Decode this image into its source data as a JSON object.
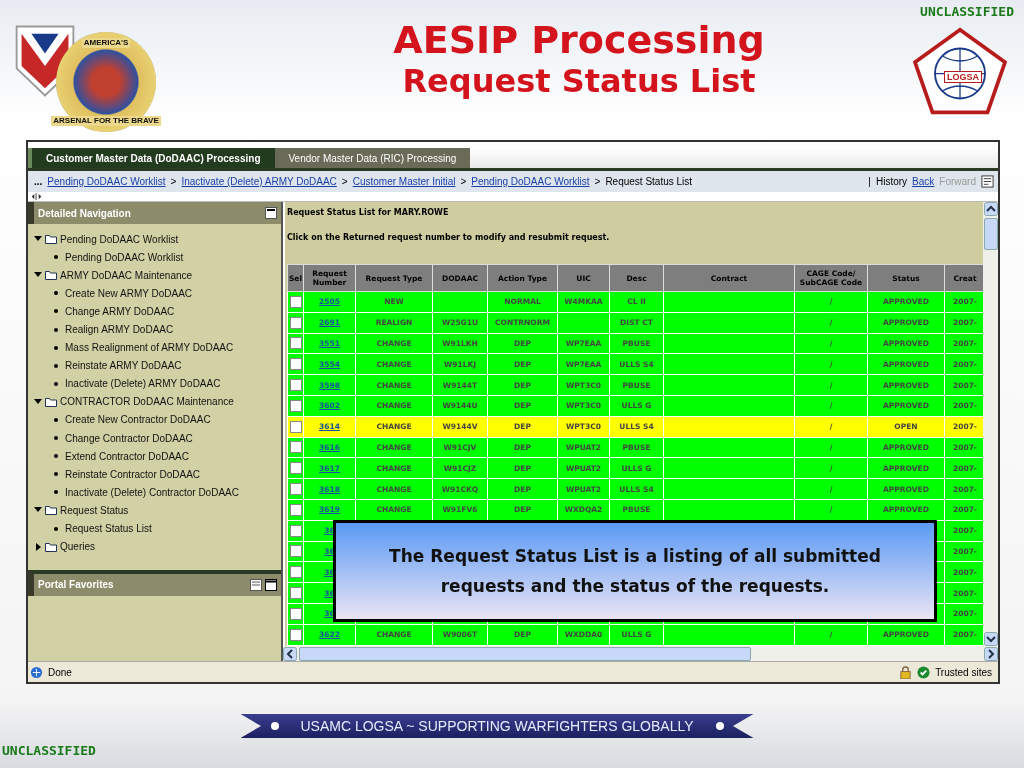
{
  "slide": {
    "title": "AESIP Processing",
    "subtitle": "Request Status List",
    "classification_top": "UNCLASSIFIED",
    "classification_bottom": "UNCLASSIFIED",
    "banner": "USAMC LOGSA ~ SUPPORTING WARFIGHTERS GLOBALLY",
    "left_logo": {
      "top_text": "AMERICA'S",
      "bottom_text": "ARSENAL FOR THE BRAVE"
    },
    "right_logo": {
      "text": "LOGSA"
    }
  },
  "browser": {
    "tabs": [
      {
        "label": "Customer Master Data (DoDAAC) Processing",
        "selected": true
      },
      {
        "label": "Vendor Master Data (RIC) Processing",
        "selected": false
      }
    ],
    "breadcrumb": {
      "lead": "...",
      "items": [
        {
          "label": "Pending DoDAAC Worklist",
          "link": true
        },
        {
          "label": "Inactivate (Delete) ARMY DoDAAC",
          "link": true
        },
        {
          "label": "Customer Master Initial",
          "link": true
        },
        {
          "label": "Pending DoDAAC Worklist",
          "link": true
        },
        {
          "label": "Request Status List",
          "link": false
        }
      ],
      "separator": ">"
    },
    "history": {
      "divider": "|",
      "history": "History",
      "back": "Back",
      "forward": "Forward"
    },
    "navigation": {
      "title": "Detailed Navigation",
      "tree": [
        {
          "label": "Pending DoDAAC Worklist",
          "expanded": true,
          "children": [
            {
              "label": "Pending DoDAAC Worklist"
            }
          ]
        },
        {
          "label": "ARMY DoDAAC Maintenance",
          "expanded": true,
          "children": [
            {
              "label": "Create New ARMY DoDAAC"
            },
            {
              "label": "Change ARMY DoDAAC"
            },
            {
              "label": "Realign ARMY DoDAAC"
            },
            {
              "label": "Mass Realignment of ARMY DoDAAC"
            },
            {
              "label": "Reinstate ARMY DoDAAC"
            },
            {
              "label": "Inactivate (Delete) ARMY DoDAAC"
            }
          ]
        },
        {
          "label": "CONTRACTOR DoDAAC Maintenance",
          "expanded": true,
          "children": [
            {
              "label": "Create New Contractor DoDAAC"
            },
            {
              "label": "Change Contractor DoDAAC"
            },
            {
              "label": "Extend Contractor DoDAAC"
            },
            {
              "label": "Reinstate Contractor DoDAAC"
            },
            {
              "label": "Inactivate (Delete) Contractor DoDAAC"
            }
          ]
        },
        {
          "label": "Request Status",
          "expanded": true,
          "children": [
            {
              "label": "Request Status List"
            }
          ]
        },
        {
          "label": "Queries",
          "expanded": false
        }
      ],
      "favorites_title": "Portal Favorites"
    },
    "content": {
      "heading": "Request Status List for MARY.ROWE",
      "instruction": "Click on the Returned request number to modify and resubmit request.",
      "columns": [
        "Sel",
        "Request Number",
        "Request Type",
        "DODAAC",
        "Action Type",
        "UIC",
        "Desc",
        "Contract",
        "CAGE Code/ SubCAGE Code",
        "Status",
        "Creat"
      ],
      "rows": [
        {
          "checked": false,
          "color": "#00ff00",
          "number": "2505",
          "request_type": "NEW",
          "dodaac": "",
          "action_type": "NORMAL",
          "uic": "W4MKAA",
          "desc": "CL II",
          "cage": "/",
          "status": "APPROVED",
          "created": "2007-"
        },
        {
          "checked": false,
          "color": "#00ff00",
          "number": "2691",
          "request_type": "REALIGN",
          "dodaac": "W25G1U",
          "action_type": "CONTRNORM",
          "uic": "",
          "desc": "DIST CT",
          "cage": "/",
          "status": "APPROVED",
          "created": "2007-"
        },
        {
          "checked": false,
          "color": "#00ff00",
          "number": "3551",
          "request_type": "CHANGE",
          "dodaac": "W91LKH",
          "action_type": "DEP",
          "uic": "WP7EAA",
          "desc": "PBUSE",
          "cage": "/",
          "status": "APPROVED",
          "created": "2007-"
        },
        {
          "checked": false,
          "color": "#00ff00",
          "number": "3554",
          "request_type": "CHANGE",
          "dodaac": "W91LKJ",
          "action_type": "DEP",
          "uic": "WP7EAA",
          "desc": "ULLS S4",
          "cage": "/",
          "status": "APPROVED",
          "created": "2007-"
        },
        {
          "checked": false,
          "color": "#00ff00",
          "number": "3598",
          "request_type": "CHANGE",
          "dodaac": "W9144T",
          "action_type": "DEP",
          "uic": "WPT3C0",
          "desc": "PBUSE",
          "cage": "/",
          "status": "APPROVED",
          "created": "2007-"
        },
        {
          "checked": false,
          "color": "#00ff00",
          "number": "3602",
          "request_type": "CHANGE",
          "dodaac": "W9144U",
          "action_type": "DEP",
          "uic": "WPT3C0",
          "desc": "ULLS G",
          "cage": "/",
          "status": "APPROVED",
          "created": "2007-"
        },
        {
          "checked": false,
          "color": "#ffff00",
          "number": "3614",
          "request_type": "CHANGE",
          "dodaac": "W9144V",
          "action_type": "DEP",
          "uic": "WPT3C0",
          "desc": "ULLS S4",
          "cage": "/",
          "status": "OPEN",
          "created": "2007-"
        },
        {
          "checked": false,
          "color": "#00ff00",
          "number": "3616",
          "request_type": "CHANGE",
          "dodaac": "W91CJV",
          "action_type": "DEP",
          "uic": "WPUAT2",
          "desc": "PBUSE",
          "cage": "/",
          "status": "APPROVED",
          "created": "2007-"
        },
        {
          "checked": false,
          "color": "#00ff00",
          "number": "3617",
          "request_type": "CHANGE",
          "dodaac": "W91CJZ",
          "action_type": "DEP",
          "uic": "WPUAT2",
          "desc": "ULLS G",
          "cage": "/",
          "status": "APPROVED",
          "created": "2007-"
        },
        {
          "checked": false,
          "color": "#00ff00",
          "number": "3618",
          "request_type": "CHANGE",
          "dodaac": "W91CKQ",
          "action_type": "DEP",
          "uic": "WPUAT2",
          "desc": "ULLS S4",
          "cage": "/",
          "status": "APPROVED",
          "created": "2007-"
        },
        {
          "checked": false,
          "color": "#00ff00",
          "number": "3619",
          "request_type": "CHANGE",
          "dodaac": "W91FV6",
          "action_type": "DEP",
          "uic": "WXDQA2",
          "desc": "PBUSE",
          "cage": "/",
          "status": "APPROVED",
          "created": "2007-"
        },
        {
          "checked": false,
          "color": "#00ff00",
          "number": "36",
          "created": "2007-"
        },
        {
          "checked": false,
          "color": "#00ff00",
          "number": "36",
          "created": "2007-"
        },
        {
          "checked": false,
          "color": "#00ff00",
          "number": "36",
          "created": "2007-"
        },
        {
          "checked": false,
          "color": "#00ff00",
          "number": "36",
          "created": "2007-"
        },
        {
          "checked": false,
          "color": "#00ff00",
          "number": "36",
          "created": "2007-"
        },
        {
          "checked": false,
          "color": "#00ff00",
          "number": "3622",
          "request_type": "CHANGE",
          "dodaac": "W9006T",
          "action_type": "DEP",
          "uic": "WXDDA0",
          "desc": "ULLS G",
          "cage": "/",
          "status": "APPROVED",
          "created": "2007-"
        }
      ]
    },
    "status_bar": {
      "text": "Done",
      "zone": "Trusted sites"
    }
  },
  "callout": "The Request Status List is a listing of all submitted requests and the status of the requests."
}
